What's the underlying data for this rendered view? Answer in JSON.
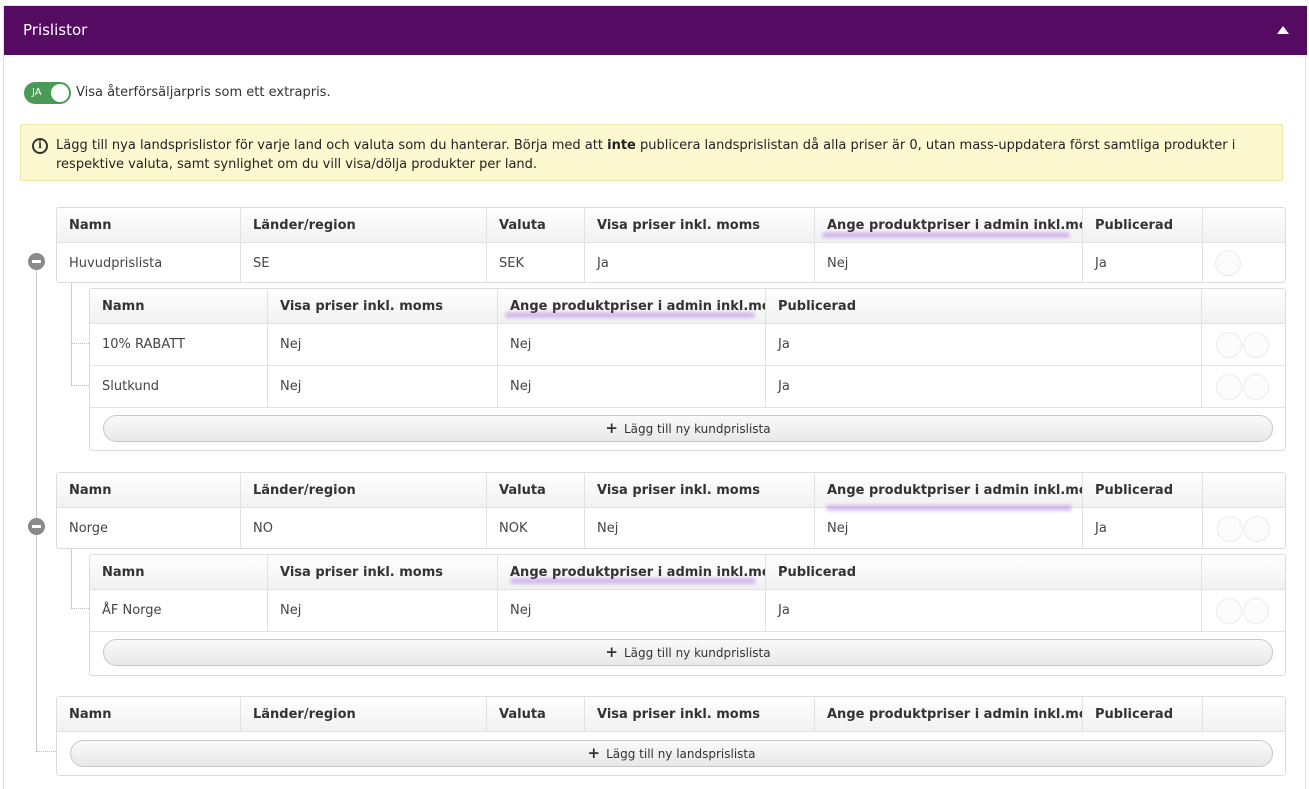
{
  "panel": {
    "title": "Prislistor"
  },
  "toggle": {
    "state_label": "JA",
    "text": "Visa återförsäljarpris som ett extrapris."
  },
  "info": {
    "text_before": "Lägg till nya landsprislistor för varje land och valuta som du hanterar. Börja med att ",
    "text_bold": "inte",
    "text_after": " publicera landsprislistan då alla priser är 0, utan mass-uppdatera först samtliga produkter i respektive valuta, samt synlighet om du vill visa/dölja produkter per land."
  },
  "country_headers": [
    "Namn",
    "Länder/region",
    "Valuta",
    "Visa priser inkl. moms",
    "Ange produktpriser i admin inkl.moms",
    "Publicerad"
  ],
  "customer_headers": [
    "Namn",
    "Visa priser inkl. moms",
    "Ange produktpriser i admin inkl.moms",
    "Publicerad"
  ],
  "countries": [
    {
      "name": "Huvudprislista",
      "region": "SE",
      "currency": "SEK",
      "show_vat": "Ja",
      "admin_vat": "Nej",
      "published": "Ja",
      "customer_lists": [
        {
          "name": "10% RABATT",
          "show_vat": "Nej",
          "admin_vat": "Nej",
          "published": "Ja"
        },
        {
          "name": "Slutkund",
          "show_vat": "Nej",
          "admin_vat": "Nej",
          "published": "Ja"
        }
      ]
    },
    {
      "name": "Norge",
      "region": "NO",
      "currency": "NOK",
      "show_vat": "Nej",
      "admin_vat": "Nej",
      "published": "Ja",
      "customer_lists": [
        {
          "name": "ÅF Norge",
          "show_vat": "Nej",
          "admin_vat": "Nej",
          "published": "Ja"
        }
      ]
    }
  ],
  "buttons": {
    "add_customer_list": "Lägg till ny kundprislista",
    "add_country_list": "Lägg till ny landsprislista"
  },
  "icons": {
    "collapse": "caret-up-icon",
    "info": "info-circle-icon",
    "expand_toggle": "minus-circle-icon",
    "plus": "plus-icon"
  },
  "colors": {
    "header_bg": "#560b63",
    "toggle_on": "#4a9a55",
    "info_bg": "#fcf9d0"
  }
}
